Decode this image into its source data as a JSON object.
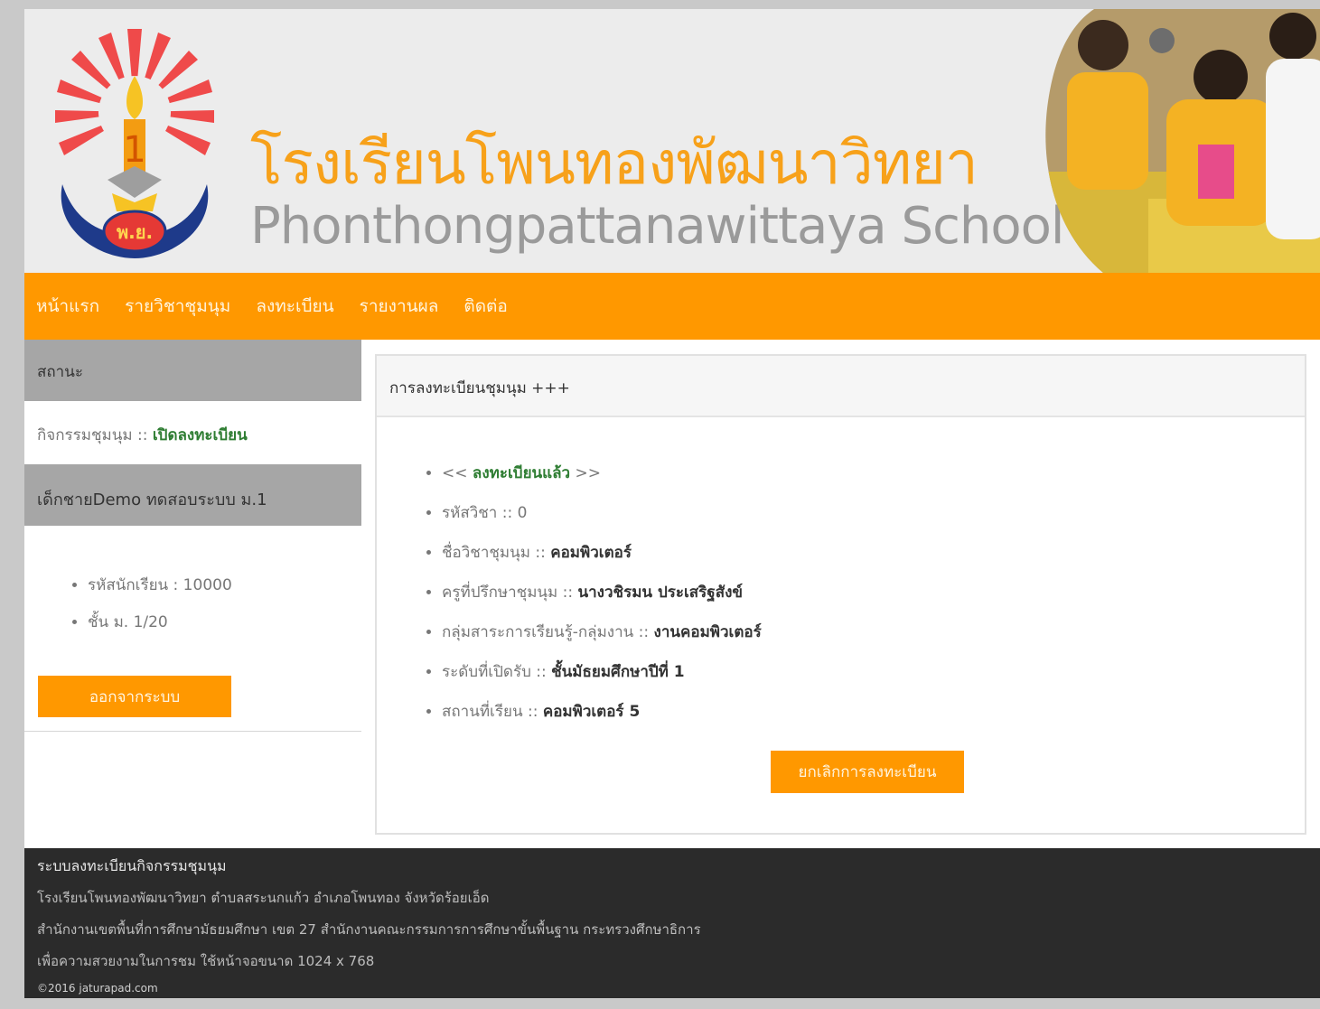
{
  "header": {
    "title_th": "โรงเรียนโพนทองพัฒนาวิทยา",
    "title_en": "Phonthongpattanawittaya  School"
  },
  "nav": {
    "items": [
      "หน้าแรก",
      "รายวิชาชุมนุม",
      "ลงทะเบียน",
      "รายงานผล",
      "ติดต่อ"
    ]
  },
  "sidebar": {
    "status_heading": "สถานะ",
    "status_label": "กิจกรรมชุมนุม :: ",
    "status_value": "เปิดลงทะเบียน",
    "user_name": "เด็กชายDemo ทดสอบระบบ ม.1",
    "student_id": "รหัสนักเรียน : 10000",
    "class": "ชั้น ม. 1/20",
    "logout_label": "ออกจากระบบ"
  },
  "panel": {
    "heading": "การลงทะเบียนชุมนุม +++",
    "registered_prefix": "<< ",
    "registered": "ลงทะเบียนแล้ว",
    "registered_suffix": " >>",
    "course_code_label": "รหัสวิชา :: ",
    "course_code": "0",
    "course_name_label": "ชื่อวิชาชุมนุม :: ",
    "course_name": "คอมพิวเตอร์",
    "advisor_label": "ครูที่ปรึกษาชุมนุม :: ",
    "advisor": "นางวชิรมน  ประเสริฐสังข์",
    "group_label": "กลุ่มสาระการเรียนรู้-กลุ่มงาน :: ",
    "group": "งานคอมพิวเตอร์",
    "level_label": "ระดับที่เปิดรับ :: ",
    "level": "ชั้นมัธยมศึกษาปีที่ 1",
    "location_label": "สถานที่เรียน :: ",
    "location": "คอมพิวเตอร์ 5",
    "cancel_label": "ยกเลิกการลงทะเบียน"
  },
  "footer": {
    "title": "ระบบลงทะเบียนกิจกรรมชุมนุม",
    "line1": "โรงเรียนโพนทองพัฒนาวิทยา ตำบลสระนกแก้ว อำเภอโพนทอง จังหวัดร้อยเอ็ด",
    "line2": "สำนักงานเขตพื้นที่การศึกษามัธยมศึกษา เขต 27 สำนักงานคณะกรรมการการศึกษาขั้นพื้นฐาน กระทรวงศึกษาธิการ",
    "line3": "เพื่อความสวยงามในการชม ใช้หน้าจอขนาด 1024 x 768",
    "copyright": "©2016 jaturapad.com"
  },
  "colors": {
    "accent": "#ff9800",
    "title_orange": "#f7a11a",
    "status_green": "#2e7d32",
    "footer_bg": "#2b2b2b"
  }
}
